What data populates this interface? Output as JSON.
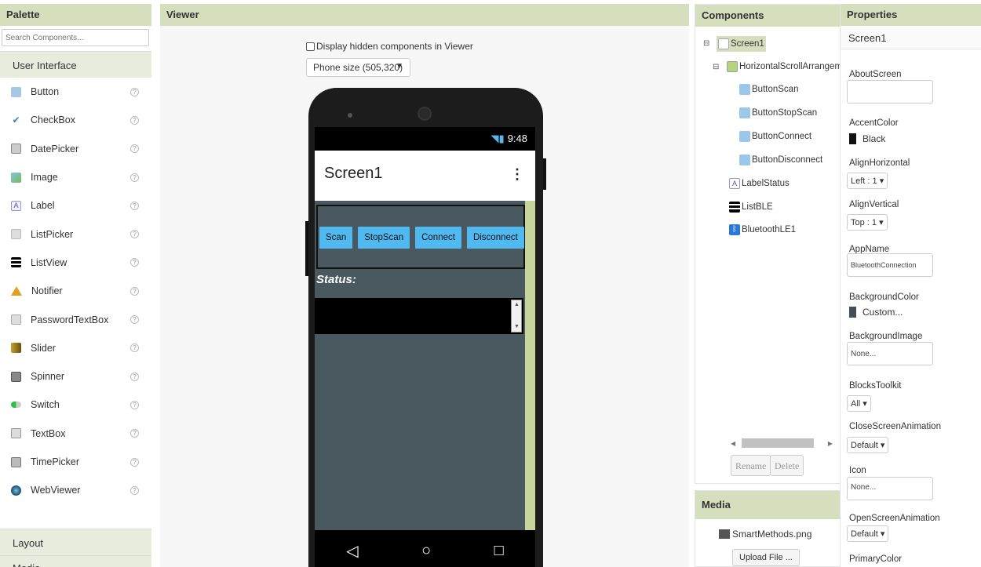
{
  "palette": {
    "title": "Palette",
    "search_placeholder": "Search Components...",
    "category_user_interface": "User Interface",
    "items": [
      {
        "label": "Button",
        "icon": "button-icon"
      },
      {
        "label": "CheckBox",
        "icon": "checkbox-icon"
      },
      {
        "label": "DatePicker",
        "icon": "datepicker-icon"
      },
      {
        "label": "Image",
        "icon": "image-icon"
      },
      {
        "label": "Label",
        "icon": "label-icon"
      },
      {
        "label": "ListPicker",
        "icon": "listpicker-icon"
      },
      {
        "label": "ListView",
        "icon": "listview-icon"
      },
      {
        "label": "Notifier",
        "icon": "notifier-icon"
      },
      {
        "label": "PasswordTextBox",
        "icon": "passwordtextbox-icon"
      },
      {
        "label": "Slider",
        "icon": "slider-icon"
      },
      {
        "label": "Spinner",
        "icon": "spinner-icon"
      },
      {
        "label": "Switch",
        "icon": "switch-icon"
      },
      {
        "label": "TextBox",
        "icon": "textbox-icon"
      },
      {
        "label": "TimePicker",
        "icon": "timepicker-icon"
      },
      {
        "label": "WebViewer",
        "icon": "webviewer-icon"
      }
    ],
    "help": "?",
    "category_layout": "Layout",
    "category_media": "Media"
  },
  "viewer": {
    "title": "Viewer",
    "hidden_checkbox_label": "Display hidden components in Viewer",
    "phone_size": "Phone size (505,320)",
    "status_time": "9:48",
    "screen_title": "Screen1",
    "menu_glyph": "⋮",
    "buttons": [
      "Scan",
      "StopScan",
      "Connect",
      "Disconnect"
    ],
    "status_label": "Status:",
    "nav_back": "◁",
    "nav_home": "○",
    "nav_recent": "□"
  },
  "components": {
    "title": "Components",
    "tree": {
      "screen": "Screen1",
      "hsa": "HorizontalScrollArrangem",
      "btn_scan": "ButtonScan",
      "btn_stop": "ButtonStopScan",
      "btn_connect": "ButtonConnect",
      "btn_disconnect": "ButtonDisconnect",
      "label_status": "LabelStatus",
      "list_ble": "ListBLE",
      "bluetooth": "BluetoothLE1"
    },
    "collapse_glyph": "⊟",
    "rename": "Rename",
    "delete": "Delete"
  },
  "media": {
    "title": "Media",
    "file": "SmartMethods.png",
    "upload": "Upload File ..."
  },
  "properties": {
    "title": "Properties",
    "component": "Screen1",
    "about_screen_label": "AboutScreen",
    "about_screen_value": "",
    "accent_color_label": "AccentColor",
    "accent_color_value": "Black",
    "align_horizontal_label": "AlignHorizontal",
    "align_horizontal_value": "Left : 1 ▾",
    "align_vertical_label": "AlignVertical",
    "align_vertical_value": "Top : 1 ▾",
    "app_name_label": "AppName",
    "app_name_value": "BluetoothConnection",
    "background_color_label": "BackgroundColor",
    "background_color_value": "Custom...",
    "background_image_label": "BackgroundImage",
    "background_image_value": "None...",
    "blocks_toolkit_label": "BlocksToolkit",
    "blocks_toolkit_value": "All ▾",
    "close_anim_label": "CloseScreenAnimation",
    "close_anim_value": "Default ▾",
    "icon_label": "Icon",
    "icon_value": "None...",
    "open_anim_label": "OpenScreenAnimation",
    "open_anim_value": "Default ▾",
    "primary_color_label": "PrimaryColor"
  },
  "colors": {
    "header_bg": "#d6dfbd",
    "button_blue": "#50b9f0",
    "screen_bg": "#4a5860",
    "accent_black": "#111111",
    "custom_swatch": "#444c55"
  }
}
